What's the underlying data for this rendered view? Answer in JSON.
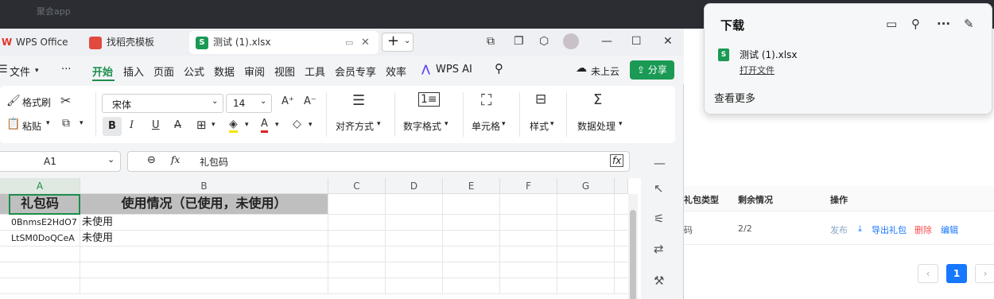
{
  "browser_bg": {
    "top_tab_text": "聚会app",
    "table": {
      "headers": [
        "礼包类型",
        "剩余情况",
        "操作"
      ],
      "row": {
        "type": "码",
        "remaining": "2/2"
      },
      "actions": [
        "发布",
        "导出礼包",
        "删除",
        "编辑"
      ],
      "export_icon": "download-icon"
    },
    "pagination": {
      "prev": "‹",
      "current": "1",
      "next": "›"
    }
  },
  "wps": {
    "tabs": [
      {
        "label": "WPS Office",
        "icon": "wps-logo-icon"
      },
      {
        "label": "找稻壳模板",
        "icon": "docer-logo-icon"
      },
      {
        "label": "测试 (1).xlsx",
        "icon": "spreadsheet-icon"
      }
    ],
    "new_tab": "+",
    "menu": {
      "file": "文件",
      "more": "···",
      "items": [
        "开始",
        "插入",
        "页面",
        "公式",
        "数据",
        "审阅",
        "视图",
        "工具",
        "会员专享",
        "效率"
      ],
      "wps_ai": "WPS AI",
      "upload": "未上云",
      "share": "分享"
    },
    "ribbon": {
      "format_painter": "格式刷",
      "paste": "粘贴",
      "font_name": "宋体",
      "font_size": "14",
      "bold": "B",
      "italic": "I",
      "underline": "U",
      "strikethrough": "A",
      "align": "对齐方式",
      "number_format": "数字格式",
      "cell": "单元格",
      "style": "样式",
      "data_process": "数据处理"
    },
    "formula_bar": {
      "cell_ref": "A1",
      "fx": "fx",
      "content": "礼包码"
    },
    "sheet": {
      "columns": [
        "A",
        "B",
        "C",
        "D",
        "E",
        "F",
        "G"
      ],
      "rows": [
        [
          "礼包码",
          "使用情况（已使用，未使用）"
        ],
        [
          "0BnmsE2HdO7",
          "未使用"
        ],
        [
          "LtSM0DoQCeA",
          "未使用"
        ]
      ]
    }
  },
  "download_panel": {
    "title": "下载",
    "file_name": "测试 (1).xlsx",
    "open_file": "打开文件",
    "see_more": "查看更多"
  }
}
